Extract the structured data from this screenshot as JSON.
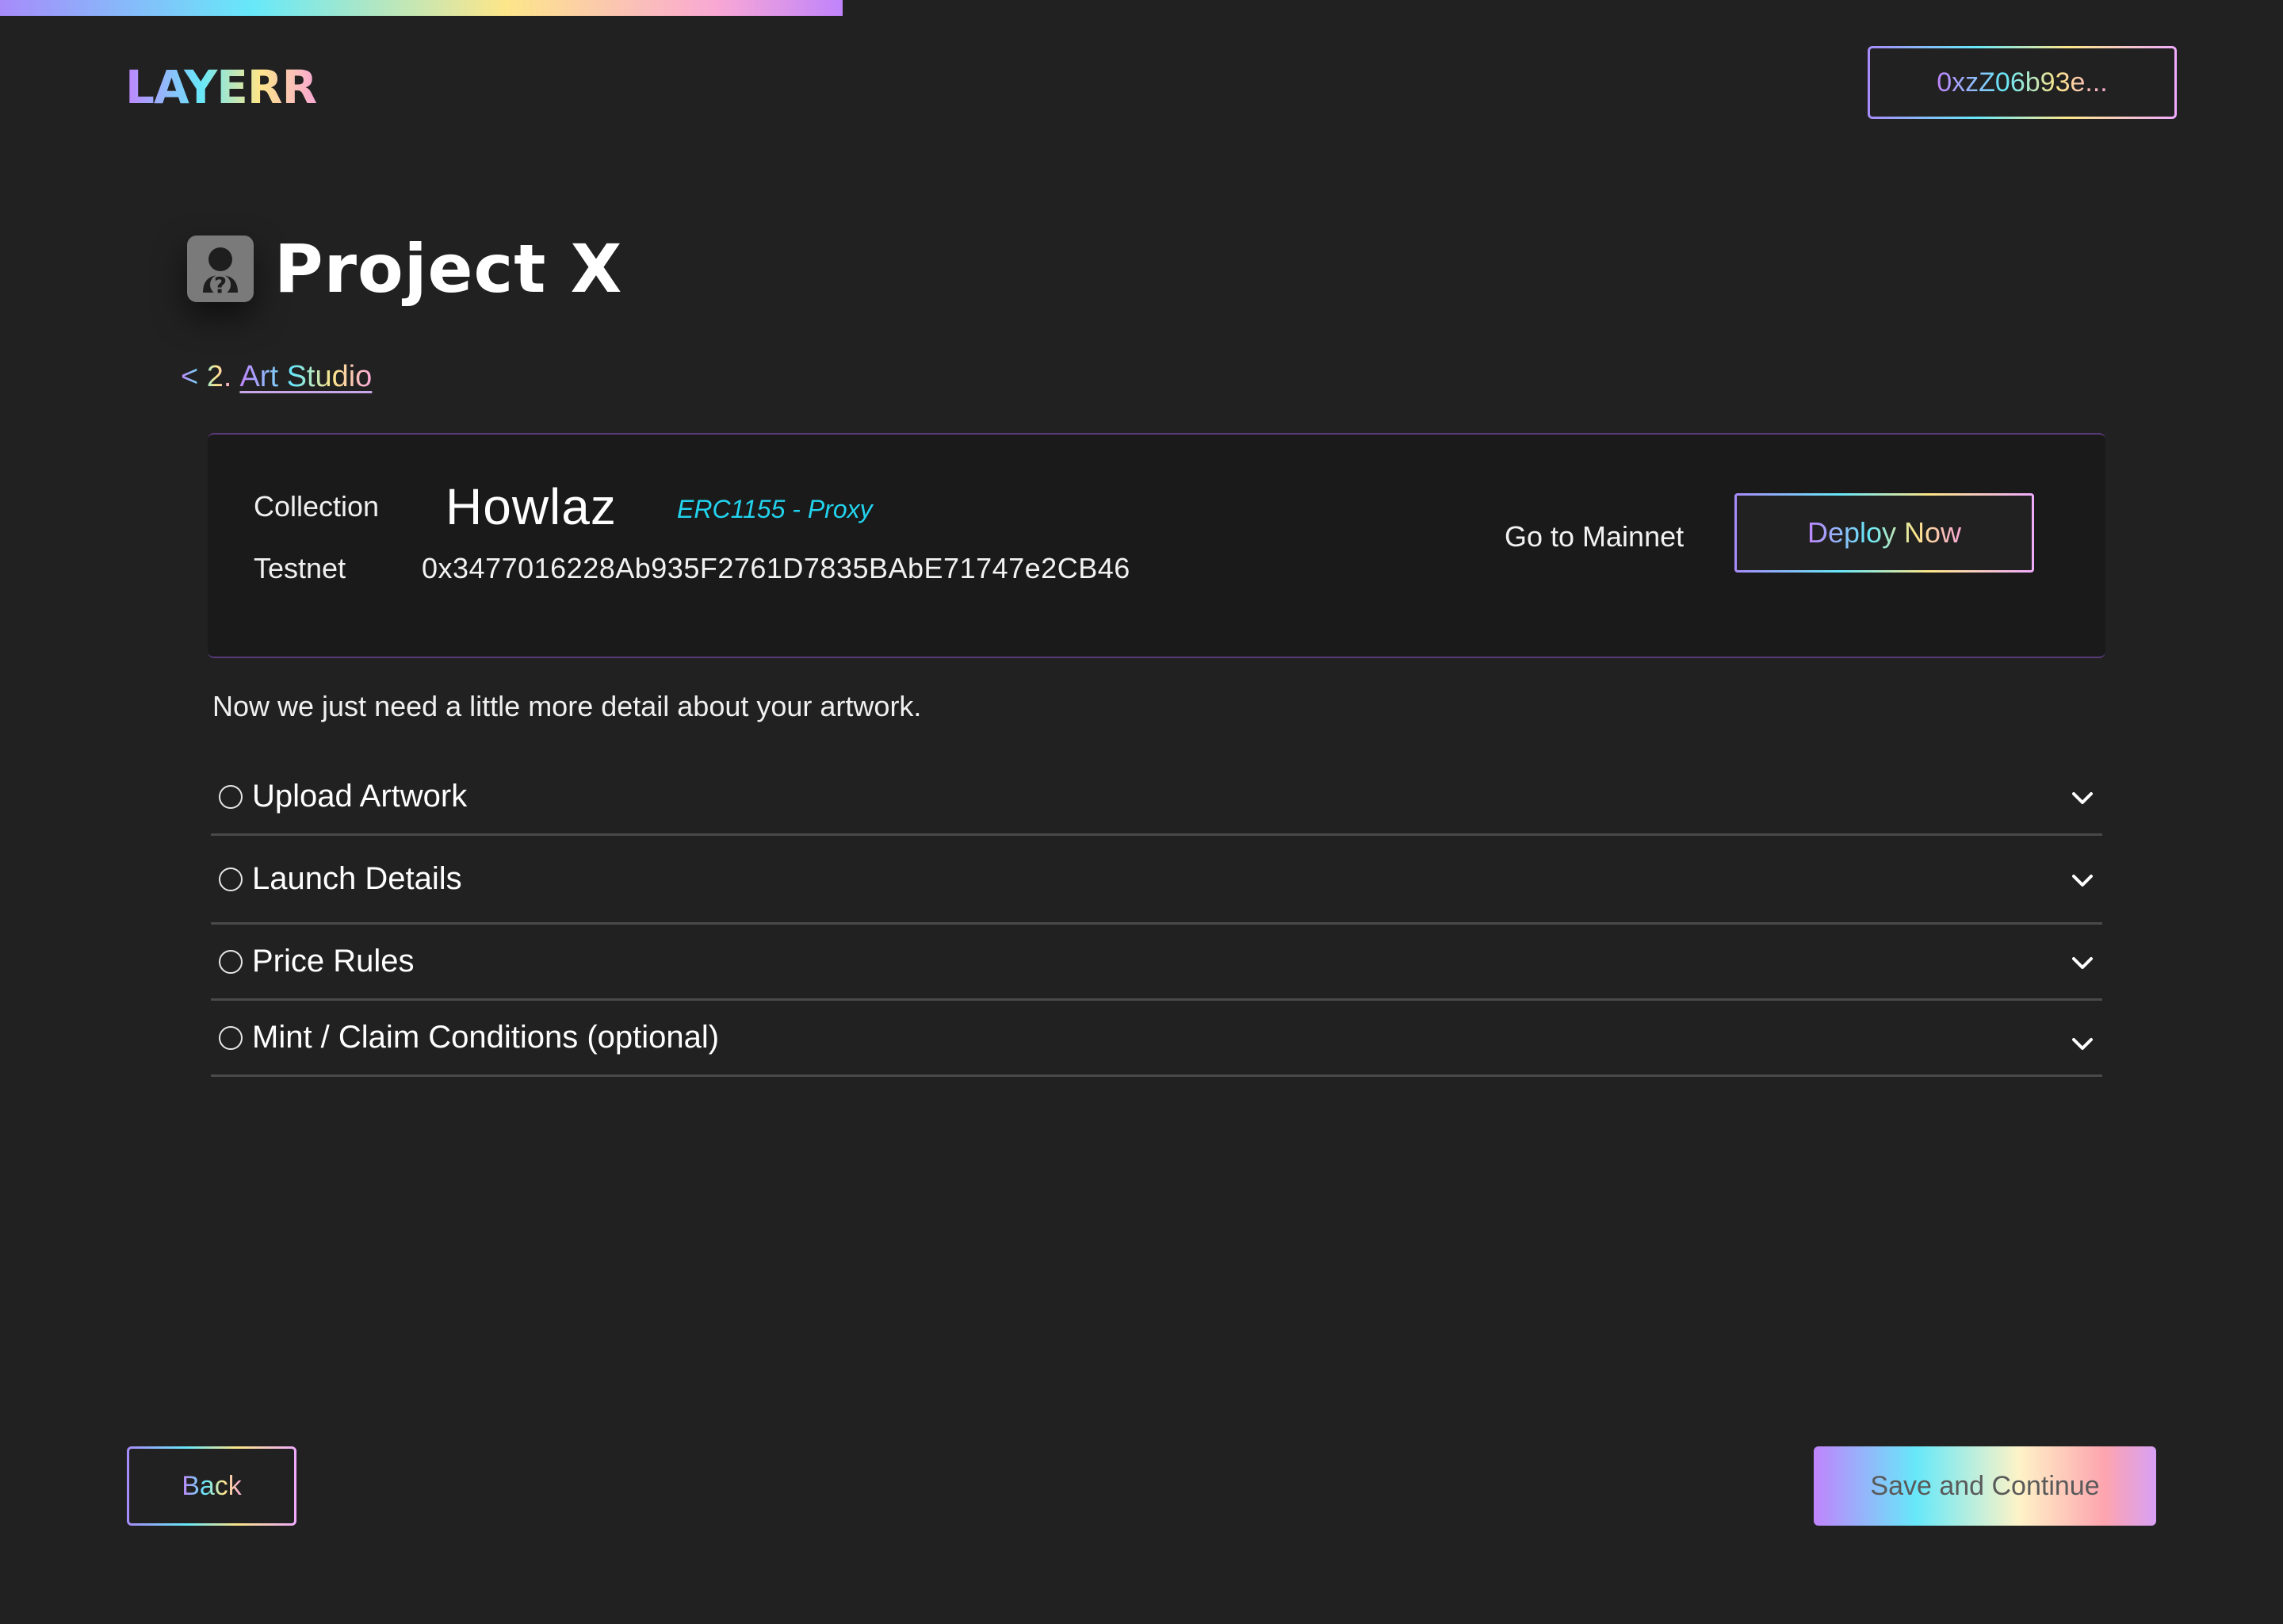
{
  "header": {
    "logo_text": "LAYERR",
    "wallet_address": "0xzZ06b93e..."
  },
  "progress": {
    "percent": 36.9
  },
  "project": {
    "title": "Project X",
    "avatar_icon": "unknown-user-icon"
  },
  "breadcrumb": {
    "prefix": "< 2.",
    "link": "Art Studio"
  },
  "collection_card": {
    "collection_label": "Collection",
    "collection_name": "Howlaz",
    "contract_type": "ERC1155 - Proxy",
    "network_label": "Testnet",
    "contract_address": "0x3477016228Ab935F2761D7835BAbE71747e2CB46",
    "mainnet_label": "Go to Mainnet",
    "deploy_label": "Deploy Now"
  },
  "intro_text": "Now we just need a little more detail about your artwork.",
  "sections": [
    {
      "label": "Upload Artwork"
    },
    {
      "label": "Launch Details"
    },
    {
      "label": "Price Rules"
    },
    {
      "label": "Mint / Claim Conditions (optional)"
    }
  ],
  "footer": {
    "back_label": "Back",
    "save_label": "Save and Continue"
  },
  "colors": {
    "background": "#212121",
    "card": "#1a1a1a",
    "accent_cyan": "#22d3ee",
    "gradient": [
      "#c084fc",
      "#67e8f9",
      "#fde68a",
      "#f9a8d4"
    ]
  }
}
